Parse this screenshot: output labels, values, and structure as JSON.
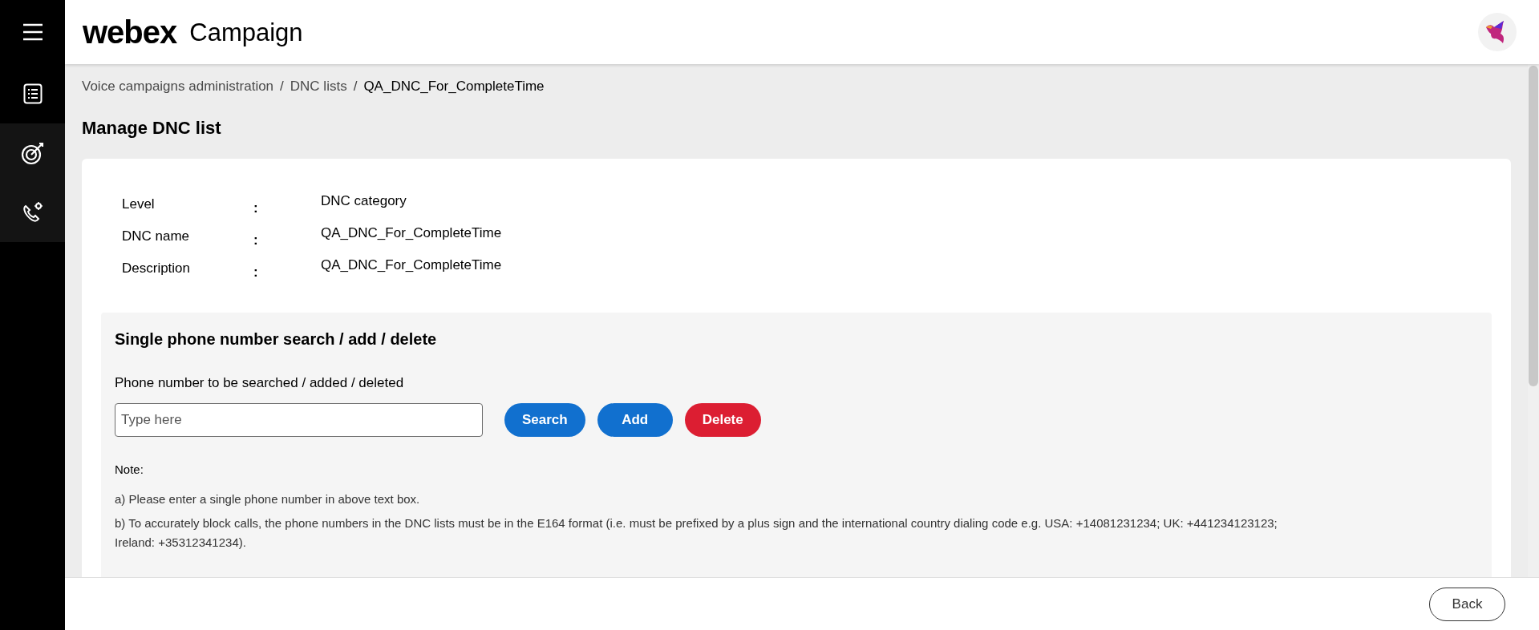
{
  "sidebar": {
    "items": [
      {
        "kind": "list",
        "selected": false
      },
      {
        "kind": "target",
        "selected": true
      },
      {
        "kind": "phone",
        "selected": true
      }
    ]
  },
  "header": {
    "brand": "webex",
    "product": "Campaign"
  },
  "breadcrumb": [
    {
      "label": "Voice campaigns administration",
      "current": false
    },
    {
      "label": "DNC lists",
      "current": false
    },
    {
      "label": "QA_DNC_For_CompleteTime",
      "current": true
    }
  ],
  "separator": "/",
  "page_title": "Manage DNC list",
  "details": [
    {
      "label": "Level",
      "colon": ":",
      "value": "DNC category"
    },
    {
      "label": "DNC name",
      "colon": ":",
      "value": "QA_DNC_For_CompleteTime"
    },
    {
      "label": "Description",
      "colon": ":",
      "value": "QA_DNC_For_CompleteTime"
    }
  ],
  "single_number": {
    "heading": "Single phone number search / add / delete",
    "field_label": "Phone number to be searched / added / deleted",
    "placeholder": "Type here",
    "buttons": [
      {
        "label": "Search",
        "kind": "primary"
      },
      {
        "label": "Add",
        "kind": "primary"
      },
      {
        "label": "Delete",
        "kind": "danger"
      }
    ],
    "note_title": "Note:",
    "notes": [
      "a) Please enter a single phone number in above text box.",
      "b) To accurately block calls, the phone numbers in the DNC lists must be in the E164 format (i.e. must be prefixed by a plus sign and the international country dialing code e.g. USA: +14081231234; UK: +441234123123; Ireland: +35312341234)."
    ]
  },
  "footer": {
    "back": "Back"
  }
}
